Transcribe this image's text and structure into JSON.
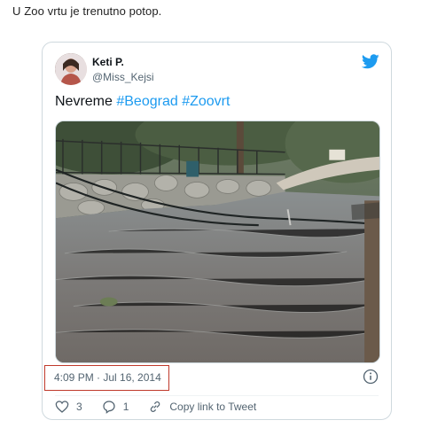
{
  "article": {
    "caption": "U Zoo vrtu je trenutno potop."
  },
  "tweet": {
    "author_name": "Keti P.",
    "handle": "@Miss_Kejsi",
    "text_plain": "Nevreme ",
    "hashtags": [
      "#Beograd",
      "#Zoovrt"
    ],
    "timestamp": "4:09 PM · Jul 16, 2014",
    "likes": "3",
    "replies": "1",
    "copy_link_label": "Copy link to Tweet"
  },
  "icons": {
    "brand": "twitter-bird-icon",
    "info": "info-icon",
    "like": "heart-icon",
    "reply": "reply-bubble-icon",
    "link": "link-icon"
  },
  "colors": {
    "accent": "#1d9bf0",
    "muted_text": "#536471",
    "highlight_box": "#c0392b",
    "border": "#cfd9de"
  }
}
